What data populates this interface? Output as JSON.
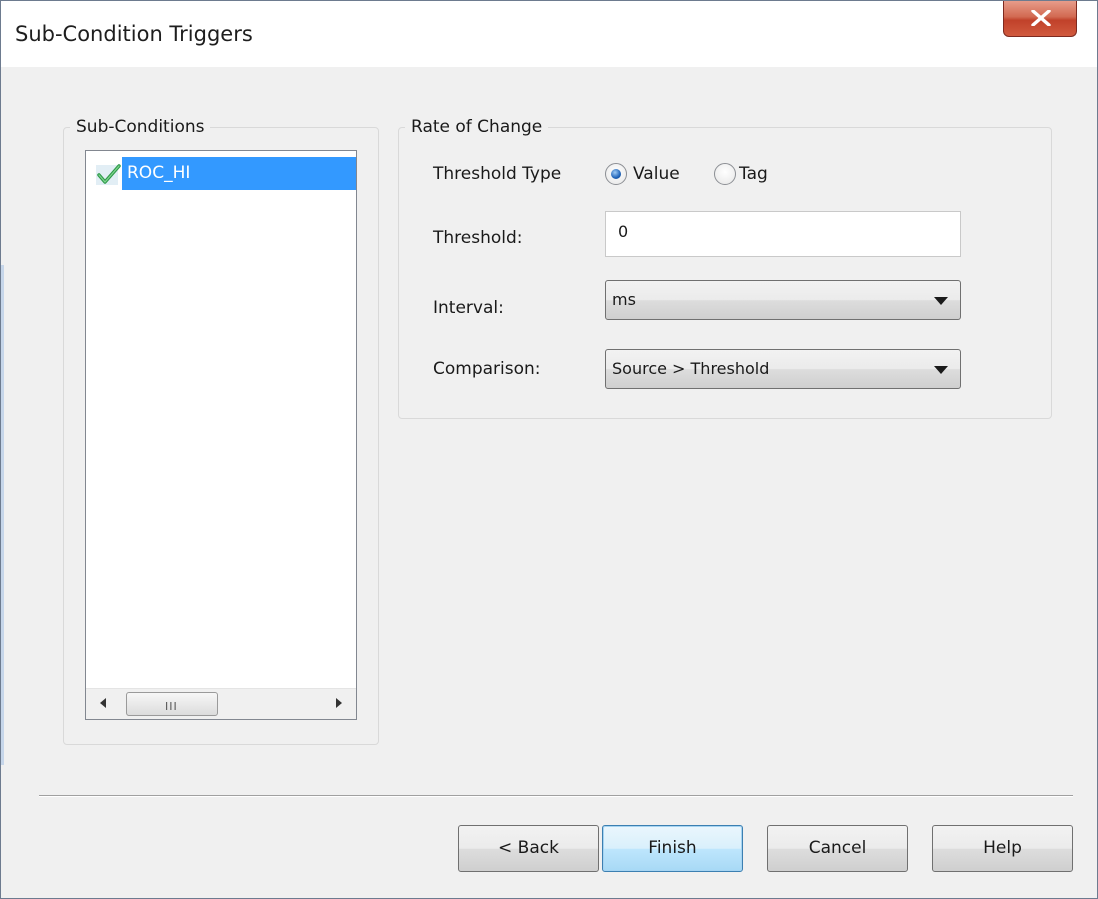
{
  "window": {
    "title": "Sub-Condition Triggers",
    "close_icon": "close-x-icon"
  },
  "subconditions": {
    "legend": "Sub-Conditions",
    "items": [
      {
        "label": "ROC_HI",
        "checked": true,
        "selected": true
      }
    ],
    "scrollbar": {
      "left_icon": "scroll-left-icon",
      "right_icon": "scroll-right-icon",
      "grip": "III"
    }
  },
  "rate_of_change": {
    "legend": "Rate of Change",
    "threshold_type": {
      "label": "Threshold Type",
      "options": [
        {
          "label": "Value",
          "checked": true
        },
        {
          "label": "Tag",
          "checked": false
        }
      ]
    },
    "threshold": {
      "label": "Threshold:",
      "value": "0"
    },
    "interval": {
      "label": "Interval:",
      "value": "ms"
    },
    "comparison": {
      "label": "Comparison:",
      "value": "Source > Threshold"
    }
  },
  "buttons": {
    "back": "< Back",
    "finish": "Finish",
    "cancel": "Cancel",
    "help": "Help"
  },
  "colors": {
    "selection": "#3399ff",
    "dialog_bg": "#f0f0f0",
    "close_button": "#c7432b"
  }
}
